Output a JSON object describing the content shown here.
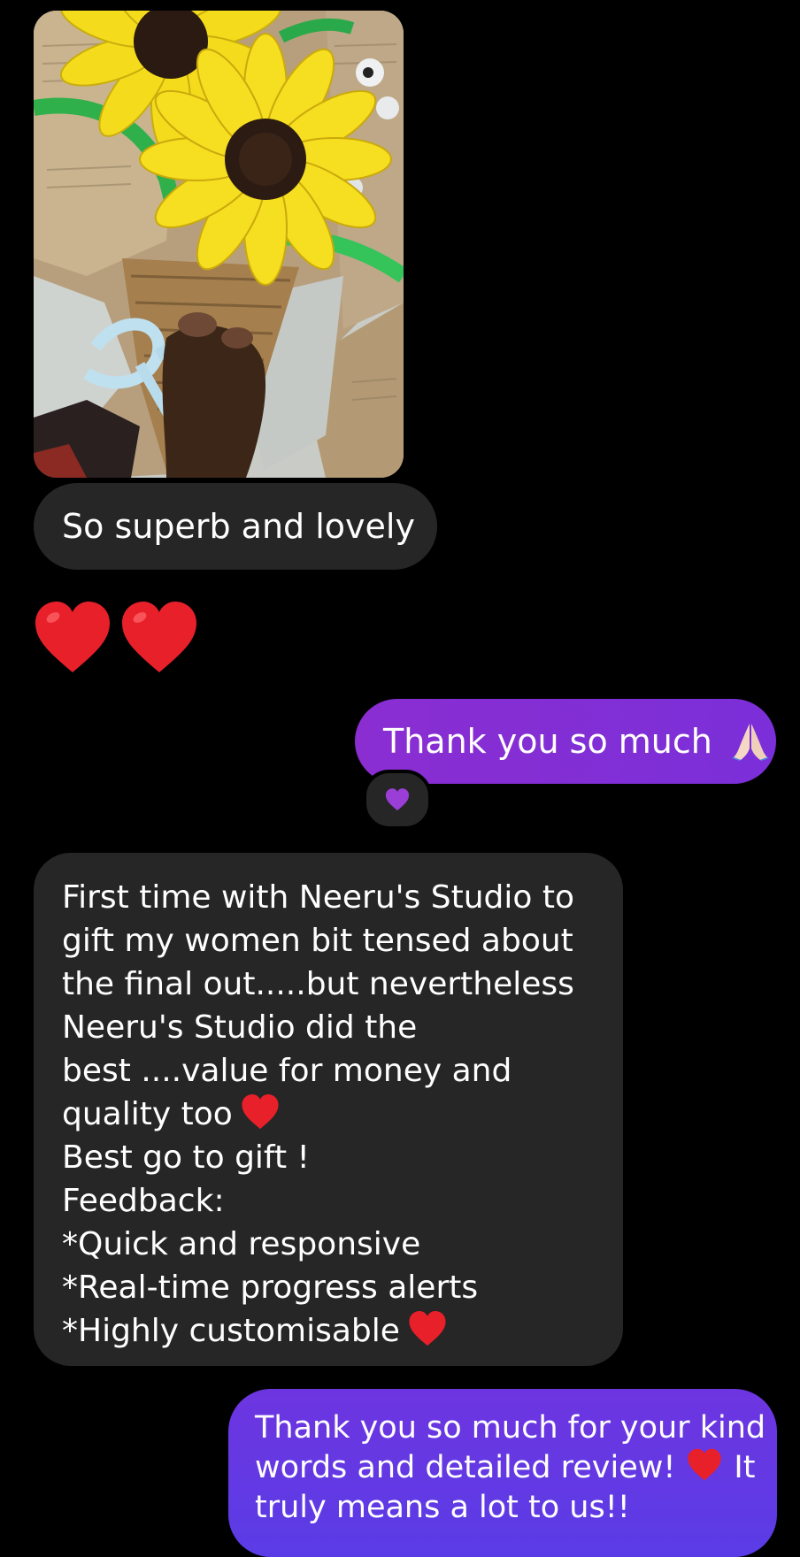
{
  "messages": {
    "received_photo_caption": "So superb and lovely",
    "sent_thanks": "Thank you so much",
    "review_lines": [
      "First time with Neeru's Studio to",
      "gift my women bit tensed about",
      "the final out.....but nevertheless",
      "Neeru's Studio did the",
      "best ....value for money and",
      "quality too",
      "Best go to gift !",
      "Feedback:",
      "*Quick and responsive",
      "*Real-time progress alerts",
      "*Highly customisable"
    ],
    "reply_lines": [
      "Thank you so much for your kind",
      "words and detailed review!",
      "It",
      "truly means a lot to us!!"
    ]
  },
  "icons": {
    "hearts": [
      "red-heart-icon",
      "red-heart-icon"
    ],
    "pray": "folded-hands-icon",
    "reaction": "purple-heart-icon"
  },
  "colors": {
    "background": "#000000",
    "received_bubble": "#262626",
    "sent_bubble": "#8a2ed2",
    "sent_bubble_2": "#6d35e0",
    "heart_red": "#e8202a",
    "heart_purple": "#9b3ed8"
  }
}
